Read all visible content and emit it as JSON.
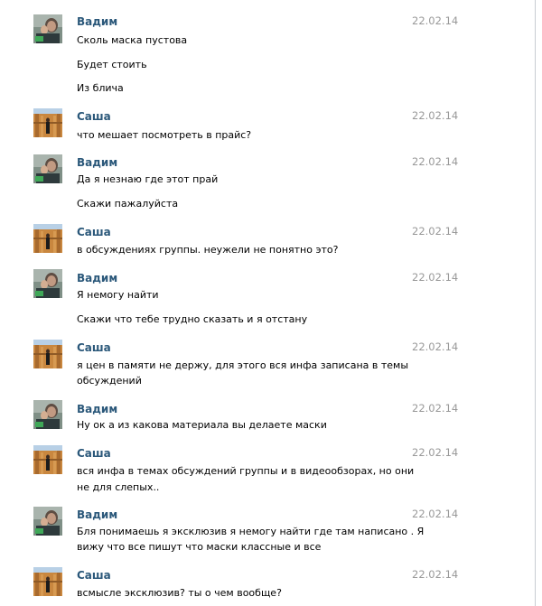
{
  "messages": [
    {
      "author": "Вадим",
      "date": "22.02.14",
      "lines": [
        "Сколь маска пустова",
        "Будет стоить",
        "Из блича"
      ]
    },
    {
      "author": "Саша",
      "date": "22.02.14",
      "lines": [
        "что мешает посмотреть в прайс?"
      ]
    },
    {
      "author": "Вадим",
      "date": "22.02.14",
      "lines": [
        "Да я незнаю где этот прай",
        "Скажи пажалуйста"
      ]
    },
    {
      "author": "Саша",
      "date": "22.02.14",
      "lines": [
        "в обсуждениях группы. неужели не понятно это?"
      ]
    },
    {
      "author": "Вадим",
      "date": "22.02.14",
      "lines": [
        "Я немогу найти",
        "Скажи что тебе трудно сказать и я отстану"
      ]
    },
    {
      "author": "Саша",
      "date": "22.02.14",
      "lines": [
        "я цен в памяти не держу, для этого вся инфа записана в темы",
        "обсуждений"
      ]
    },
    {
      "author": "Вадим",
      "date": "22.02.14",
      "lines": [
        "Ну ок а из какова материала вы делаете маски"
      ]
    },
    {
      "author": "Саша",
      "date": "22.02.14",
      "lines": [
        "вся инфа в темах обсуждений группы и в видеообзорах, но они",
        "не для слепых.."
      ]
    },
    {
      "author": "Вадим",
      "date": "22.02.14",
      "lines": [
        "Бля понимаешь я эксклюзив я немогу найти где там написано . Я",
        "вижу что все пишут что маски классные и все"
      ]
    },
    {
      "author": "Саша",
      "date": "22.02.14",
      "lines": [
        "всмысле эксклюзив? ты о чем вообще?"
      ]
    }
  ],
  "colors": {
    "author_name": "#2b587a",
    "date": "#999999",
    "text": "#000000",
    "background": "#ffffff"
  }
}
